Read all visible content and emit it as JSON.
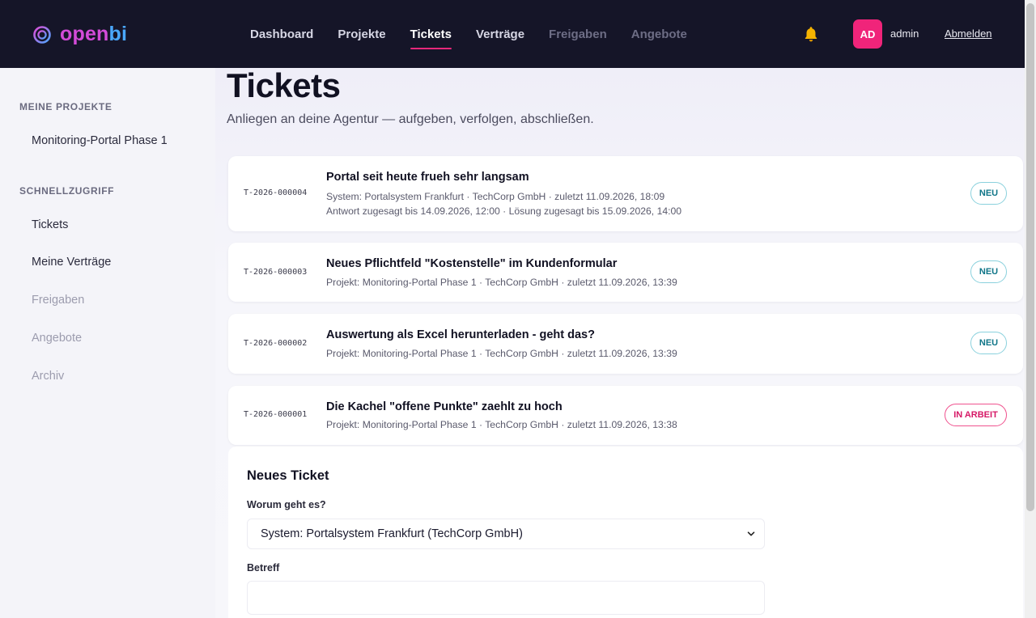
{
  "brand": {
    "part1": "open",
    "part2": "bi"
  },
  "nav": {
    "items": [
      {
        "label": "Dashboard",
        "state": "normal"
      },
      {
        "label": "Projekte",
        "state": "normal"
      },
      {
        "label": "Tickets",
        "state": "active"
      },
      {
        "label": "Verträge",
        "state": "normal"
      },
      {
        "label": "Freigaben",
        "state": "muted"
      },
      {
        "label": "Angebote",
        "state": "muted"
      }
    ]
  },
  "user": {
    "initials": "AD",
    "name": "admin",
    "logout": "Abmelden"
  },
  "icons": {
    "bell": "bell-icon",
    "chevron": "chevron-down-icon",
    "logo": "openbi-ring-logo"
  },
  "colors": {
    "accent": "#e6287a",
    "bell": "#f5b301",
    "avatar": "#f0247a",
    "brand_open": "#d34bd8",
    "brand_bi": "#4aa8ff"
  },
  "sidebar": {
    "projects_heading": "MEINE PROJEKTE",
    "projects": [
      "Monitoring-Portal Phase 1"
    ],
    "quick_heading": "SCHNELLZUGRIFF",
    "quick": [
      {
        "label": "Tickets",
        "state": "normal"
      },
      {
        "label": "Meine Verträge",
        "state": "normal"
      },
      {
        "label": "Freigaben",
        "state": "muted"
      },
      {
        "label": "Angebote",
        "state": "muted"
      },
      {
        "label": "Archiv",
        "state": "muted"
      }
    ]
  },
  "page": {
    "title": "Tickets",
    "subtitle": "Anliegen an deine Agentur — aufgeben, verfolgen, abschließen."
  },
  "tickets": [
    {
      "id": "T-2026-000004",
      "title": "Portal seit heute frueh sehr langsam",
      "meta": "System: Portalsystem Frankfurt · TechCorp GmbH · zuletzt 11.09.2026, 18:09",
      "meta2": "Antwort zugesagt bis 14.09.2026, 12:00 · Lösung zugesagt bis 15.09.2026, 14:00",
      "status": "NEU"
    },
    {
      "id": "T-2026-000003",
      "title": "Neues Pflichtfeld \"Kostenstelle\" im Kundenformular",
      "meta": "Projekt: Monitoring-Portal Phase 1 · TechCorp GmbH · zuletzt 11.09.2026, 13:39",
      "status": "NEU"
    },
    {
      "id": "T-2026-000002",
      "title": "Auswertung als Excel herunterladen - geht das?",
      "meta": "Projekt: Monitoring-Portal Phase 1 · TechCorp GmbH · zuletzt 11.09.2026, 13:39",
      "status": "NEU"
    },
    {
      "id": "T-2026-000001",
      "title": "Die Kachel \"offene Punkte\" zaehlt zu hoch",
      "meta": "Projekt: Monitoring-Portal Phase 1 · TechCorp GmbH · zuletzt 11.09.2026, 13:38",
      "status": "IN ARBEIT"
    }
  ],
  "form": {
    "title": "Neues Ticket",
    "topic_label": "Worum geht es?",
    "topic_value": "System: Portalsystem Frankfurt (TechCorp GmbH)",
    "subject_label": "Betreff",
    "subject_value": ""
  }
}
